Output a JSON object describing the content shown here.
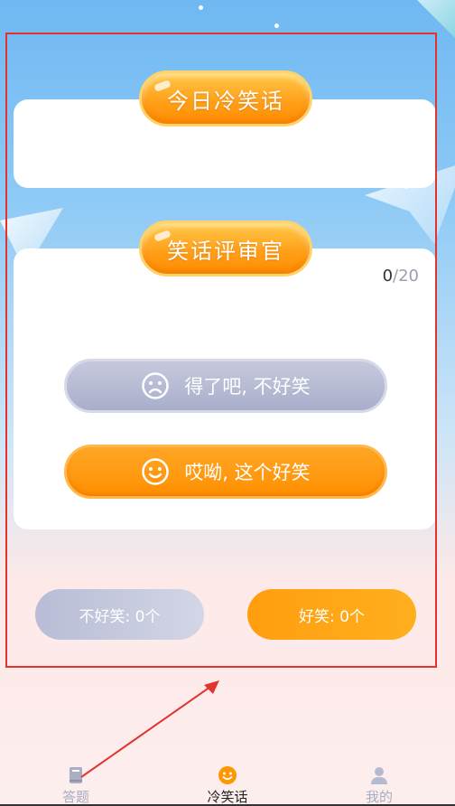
{
  "sections": {
    "joke_title": "今日冷笑话",
    "judge_title": "笑话评审官"
  },
  "counter": {
    "current": "0",
    "total": "20"
  },
  "buttons": {
    "not_funny": "得了吧, 不好笑",
    "funny": "哎呦, 这个好笑"
  },
  "stats": {
    "not_funny": "不好笑: 0个",
    "funny": "好笑: 0个"
  },
  "tabs": [
    {
      "label": "答题",
      "icon": "book-icon"
    },
    {
      "label": "冷笑话",
      "icon": "smiley-icon"
    },
    {
      "label": "我的",
      "icon": "user-icon"
    }
  ],
  "colors": {
    "accent": "#ff9800",
    "neutral": "#b8bcd6",
    "highlight_box": "#e3332f"
  }
}
